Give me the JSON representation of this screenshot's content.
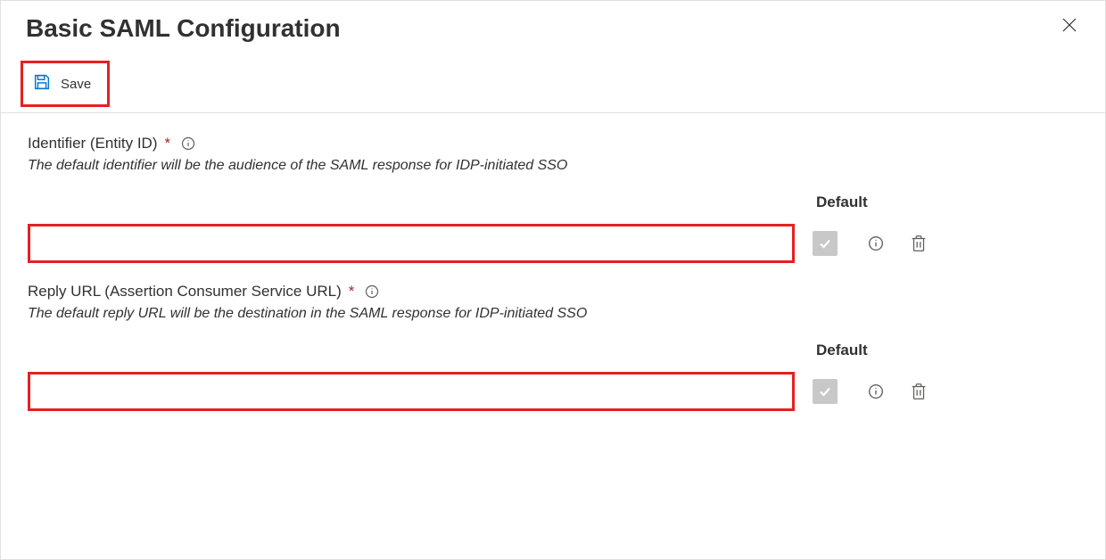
{
  "header": {
    "title": "Basic SAML Configuration"
  },
  "toolbar": {
    "save_label": "Save"
  },
  "sections": {
    "identifier": {
      "label": "Identifier (Entity ID)",
      "description": "The default identifier will be the audience of the SAML response for IDP-initiated SSO",
      "input_value": "",
      "default_header": "Default"
    },
    "reply_url": {
      "label": "Reply URL (Assertion Consumer Service URL)",
      "description": "The default reply URL will be the destination in the SAML response for IDP-initiated SSO",
      "input_value": "",
      "default_header": "Default"
    }
  },
  "symbols": {
    "required": "*"
  }
}
